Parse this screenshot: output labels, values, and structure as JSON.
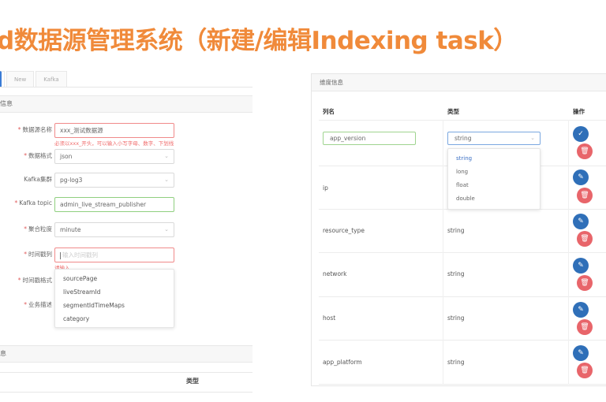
{
  "title": "d数据源管理系统（新建/编辑Indexing task）",
  "tabs": [
    "",
    "New",
    "Kafka"
  ],
  "left": {
    "section1_title": "信息",
    "section2_title": "息",
    "type_header": "类型",
    "rows": [
      {
        "label": "数据源名称",
        "required": true,
        "value": "xxx_测试数据源",
        "state": "err",
        "error": "必须以xxx_开头，可以输入小写字母、数字、下划线"
      },
      {
        "label": "数据格式",
        "required": true,
        "value": "json",
        "state": "normal"
      },
      {
        "label": "Kafka集群",
        "required": false,
        "value": "pg-log3",
        "state": "normal"
      },
      {
        "label": "Kafka topic",
        "required": true,
        "value": "admin_live_stream_publisher",
        "state": "ok"
      },
      {
        "label": "聚合粒度",
        "required": true,
        "value": "minute",
        "state": "normal"
      },
      {
        "label": "时间戳列",
        "required": true,
        "value": "",
        "placeholder": "输入时间戳列",
        "state": "err",
        "error": "请输入"
      },
      {
        "label": "时间戳格式",
        "required": true,
        "value": "",
        "state": "none"
      },
      {
        "label": "业务描述",
        "required": true,
        "value": "",
        "state": "none"
      }
    ],
    "dropdown_options": [
      "sourcePage",
      "liveStreamId",
      "segmentIdTimeMaps",
      "category"
    ]
  },
  "right": {
    "panel_title": "维度信息",
    "headers": {
      "name": "列名",
      "type": "类型",
      "action": "操作"
    },
    "edit_row": {
      "name": "app_version",
      "type": "string"
    },
    "type_options": [
      "string",
      "long",
      "float",
      "double"
    ],
    "rows": [
      {
        "name": "ip",
        "type": ""
      },
      {
        "name": "resource_type",
        "type": "string"
      },
      {
        "name": "network",
        "type": "string"
      },
      {
        "name": "host",
        "type": "string"
      },
      {
        "name": "app_platform",
        "type": "string"
      }
    ],
    "icons": {
      "confirm": "check-icon",
      "delete": "trash-icon",
      "edit": "pencil-icon"
    },
    "colors": {
      "primary": "#2f6fb8",
      "danger": "#e8656a",
      "accent": "#f08a3a"
    }
  }
}
